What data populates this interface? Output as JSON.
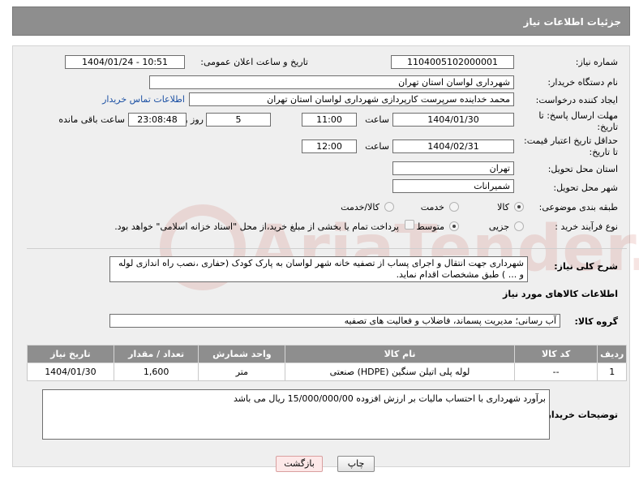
{
  "header": {
    "title": "جزئیات اطلاعات نیاز"
  },
  "fields": {
    "need_number_label": "شماره نیاز:",
    "need_number": "1104005102000001",
    "announce_label": "تاریخ و ساعت اعلان عمومی:",
    "announce_value": "1404/01/24 - 10:51",
    "buyer_org_label": "نام دستگاه خریدار:",
    "buyer_org": "شهرداری لواسان استان تهران",
    "requester_label": "ایجاد کننده درخواست:",
    "requester": "محمد خداینده سرپرست کارپردازی شهرداری لواسان استان تهران",
    "contact_link": "اطلاعات تماس خریدار",
    "reply_deadline_label_1": "مهلت ارسال پاسخ: تا",
    "reply_deadline_label_2": "تاریخ:",
    "reply_date": "1404/01/30",
    "time_label": "ساعت",
    "reply_time": "11:00",
    "days_value": "5",
    "days_label": "روز و",
    "remaining_time": "23:08:48",
    "remaining_label": "ساعت باقی مانده",
    "min_validity_label_1": "حداقل تاریخ اعتبار قیمت:",
    "min_validity_label_2": "تا تاریخ:",
    "validity_date": "1404/02/31",
    "validity_time_label": "ساعت",
    "validity_time": "12:00",
    "province_label": "استان محل تحویل:",
    "province": "تهران",
    "city_label": "شهر محل تحویل:",
    "city": "شمیرانات",
    "category_label": "طبقه بندی موضوعی:",
    "category_options": [
      "کالا",
      "خدمت",
      "کالا/خدمت"
    ],
    "purchase_type_label": "نوع فرآیند خرید :",
    "purchase_options": [
      "جزیی",
      "متوسط"
    ],
    "payment_note": "پرداخت تمام یا بخشی از مبلغ خرید،از محل \"اسناد خزانه اسلامی\" خواهد بود."
  },
  "description": {
    "label": "شرح کلی نیاز:",
    "text": "شهرداری جهت انتقال و اجرای پساب از تصفیه خانه شهر لواسان به پارک کودک (حفاری ،نصب راه اندازی لوله و ... ) طبق مشخصات اقدام نماید."
  },
  "goods": {
    "section_title": "اطلاعات کالاهای مورد نیاز",
    "group_label": "گروه کالا:",
    "group_value": "آب رسانی؛ مدیریت پسماند، فاضلاب و فعالیت های تصفیه",
    "columns": [
      "ردیف",
      "کد کالا",
      "نام کالا",
      "واحد شمارش",
      "تعداد / مقدار",
      "تاریخ نیاز"
    ],
    "rows": [
      [
        "1",
        "--",
        "لوله پلی اتیلن سنگین (HDPE) صنعتی",
        "متر",
        "1,600",
        "1404/01/30"
      ]
    ]
  },
  "buyer_notes": {
    "label": "توضیحات خریدار:",
    "text": "برآورد شهرداری با احتساب مالیات بر ارزش افزوده 15/000/000/00 ریال می باشد"
  },
  "buttons": {
    "print": "چاپ",
    "back": "بازگشت"
  },
  "watermark": {
    "text": "AriaTender.neT"
  },
  "colors": {
    "header_bg": "#8e8e8e",
    "link": "#1a4fa3",
    "back_button_bg": "#fde8e8"
  }
}
